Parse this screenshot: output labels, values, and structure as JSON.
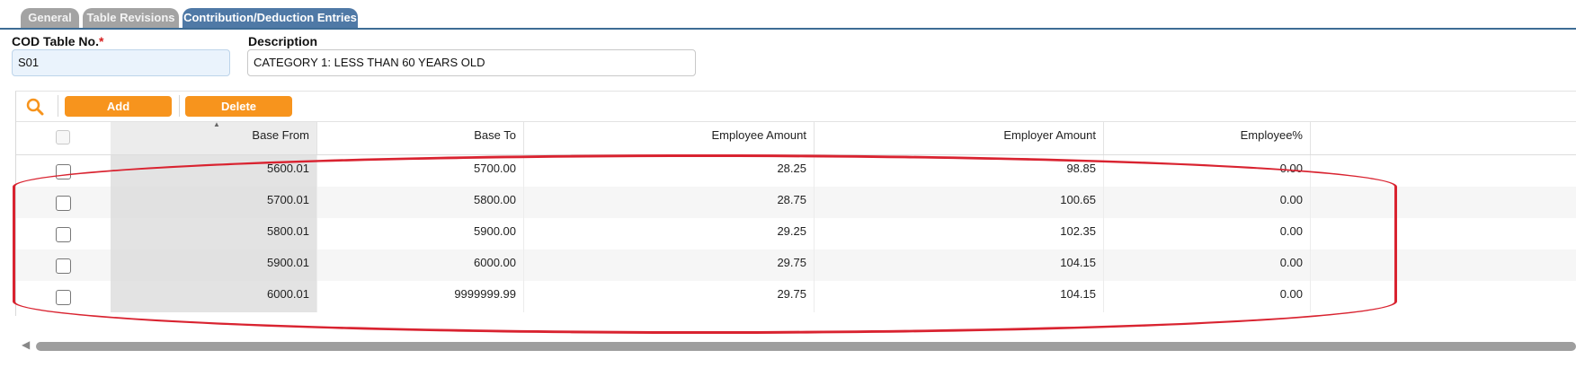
{
  "tabs": [
    {
      "label": "General",
      "active": false
    },
    {
      "label": "Table Revisions",
      "active": false
    },
    {
      "label": "Contribution/Deduction Entries",
      "active": true
    }
  ],
  "form": {
    "cod_label": "COD Table No.",
    "cod_required_mark": "*",
    "cod_value": "S01",
    "description_label": "Description",
    "description_value": "CATEGORY 1: LESS THAN 60 YEARS OLD"
  },
  "toolbar": {
    "search_icon": "search-icon",
    "add_label": "Add",
    "delete_label": "Delete"
  },
  "table": {
    "columns": [
      "Base From",
      "Base To",
      "Employee Amount",
      "Employer Amount",
      "Employee%"
    ],
    "rows": [
      {
        "base_from": "5600.01",
        "base_to": "5700.00",
        "employee_amount": "28.25",
        "employer_amount": "98.85",
        "employee_pct": "0.00"
      },
      {
        "base_from": "5700.01",
        "base_to": "5800.00",
        "employee_amount": "28.75",
        "employer_amount": "100.65",
        "employee_pct": "0.00"
      },
      {
        "base_from": "5800.01",
        "base_to": "5900.00",
        "employee_amount": "29.25",
        "employer_amount": "102.35",
        "employee_pct": "0.00"
      },
      {
        "base_from": "5900.01",
        "base_to": "6000.00",
        "employee_amount": "29.75",
        "employer_amount": "104.15",
        "employee_pct": "0.00"
      },
      {
        "base_from": "6000.01",
        "base_to": "9999999.99",
        "employee_amount": "29.75",
        "employer_amount": "104.15",
        "employee_pct": "0.00"
      }
    ]
  },
  "colors": {
    "tab_active": "#4f79a6",
    "tab_inactive": "#a3a3a3",
    "button": "#f7941d",
    "highlight": "#d92330",
    "required": "#d61f1f"
  }
}
